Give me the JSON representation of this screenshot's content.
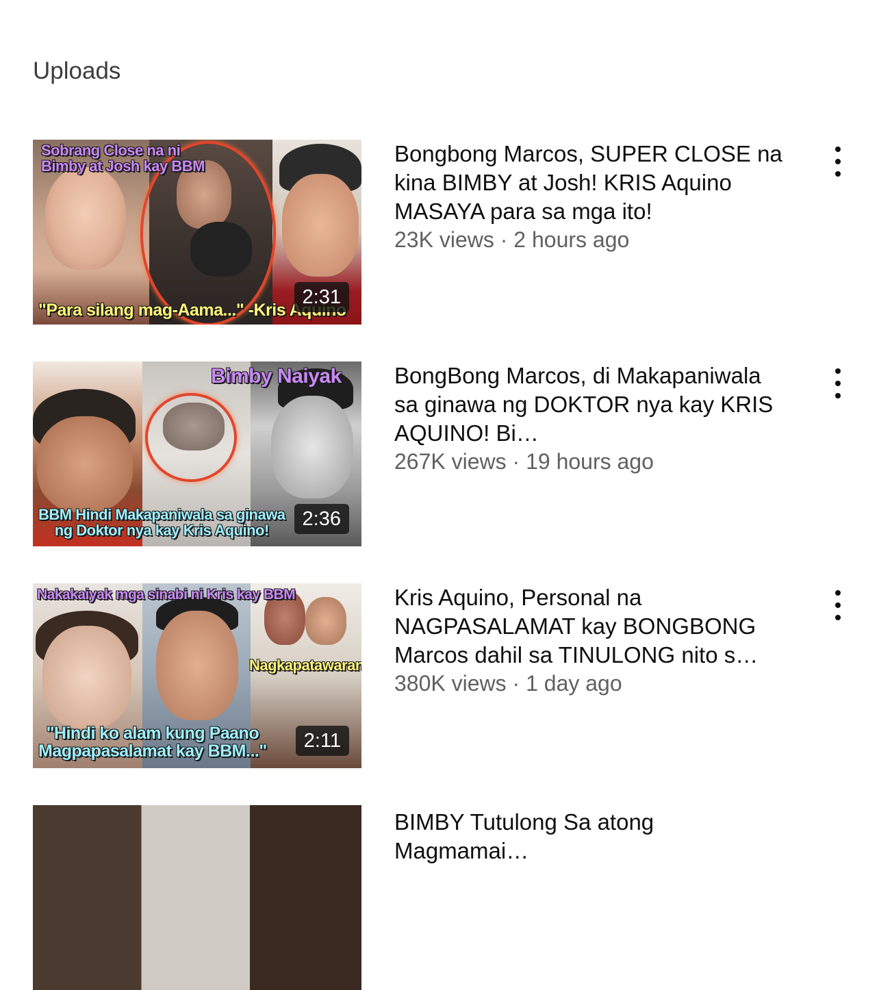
{
  "section": {
    "title": "Uploads"
  },
  "videos": [
    {
      "title": "Bongbong Marcos, SUPER CLOSE na kina BIMBY at Josh! KRIS Aquino MASAYA para sa mga ito!",
      "views": "23K views",
      "age": "2 hours ago",
      "meta": "23K views · 2 hours ago",
      "duration": "2:31",
      "thumb_text_top": "Sobrang Close na ni\nBimby at Josh kay BBM",
      "thumb_text_bottom": "\"Para silang mag-Aama...\" -Kris Aquino"
    },
    {
      "title": "BongBong Marcos, di Makapaniwala sa ginawa ng DOKTOR nya kay KRIS AQUINO! Bi…",
      "views": "267K views",
      "age": "19 hours ago",
      "meta": "267K views · 19 hours ago",
      "duration": "2:36",
      "thumb_text_top": "Bimby Naiyak",
      "thumb_text_bottom": "BBM Hindi Makapaniwala sa ginawa\nng Doktor nya kay Kris Aquino!"
    },
    {
      "title": "Kris Aquino, Personal na NAGPASALAMAT kay BONGBONG Marcos dahil sa TINULONG nito s…",
      "views": "380K views",
      "age": "1 day ago",
      "meta": "380K views · 1 day ago",
      "duration": "2:11",
      "thumb_text_top": "Nakakaiyak mga sinabi ni Kris kay BBM",
      "thumb_text_side": "Nagkapatawaran",
      "thumb_text_bottom": "\"Hindi ko alam kung Paano\nMagpapasalamat kay BBM...\""
    },
    {
      "title": "BIMBY Tutulong Sa atong Magmamai…",
      "meta": ""
    }
  ],
  "colors": {
    "title_text": "#0f0f0f",
    "meta_text": "#606060",
    "section_title": "#3c3c3c",
    "duration_bg": "#141414",
    "highlight_circle": "#e2452c",
    "thumb_caption_purple": "#c889f5",
    "thumb_caption_cyan": "#9ff0ff",
    "thumb_caption_yellow": "#fff47a"
  },
  "icons": {
    "menu": "more-vert-icon"
  }
}
